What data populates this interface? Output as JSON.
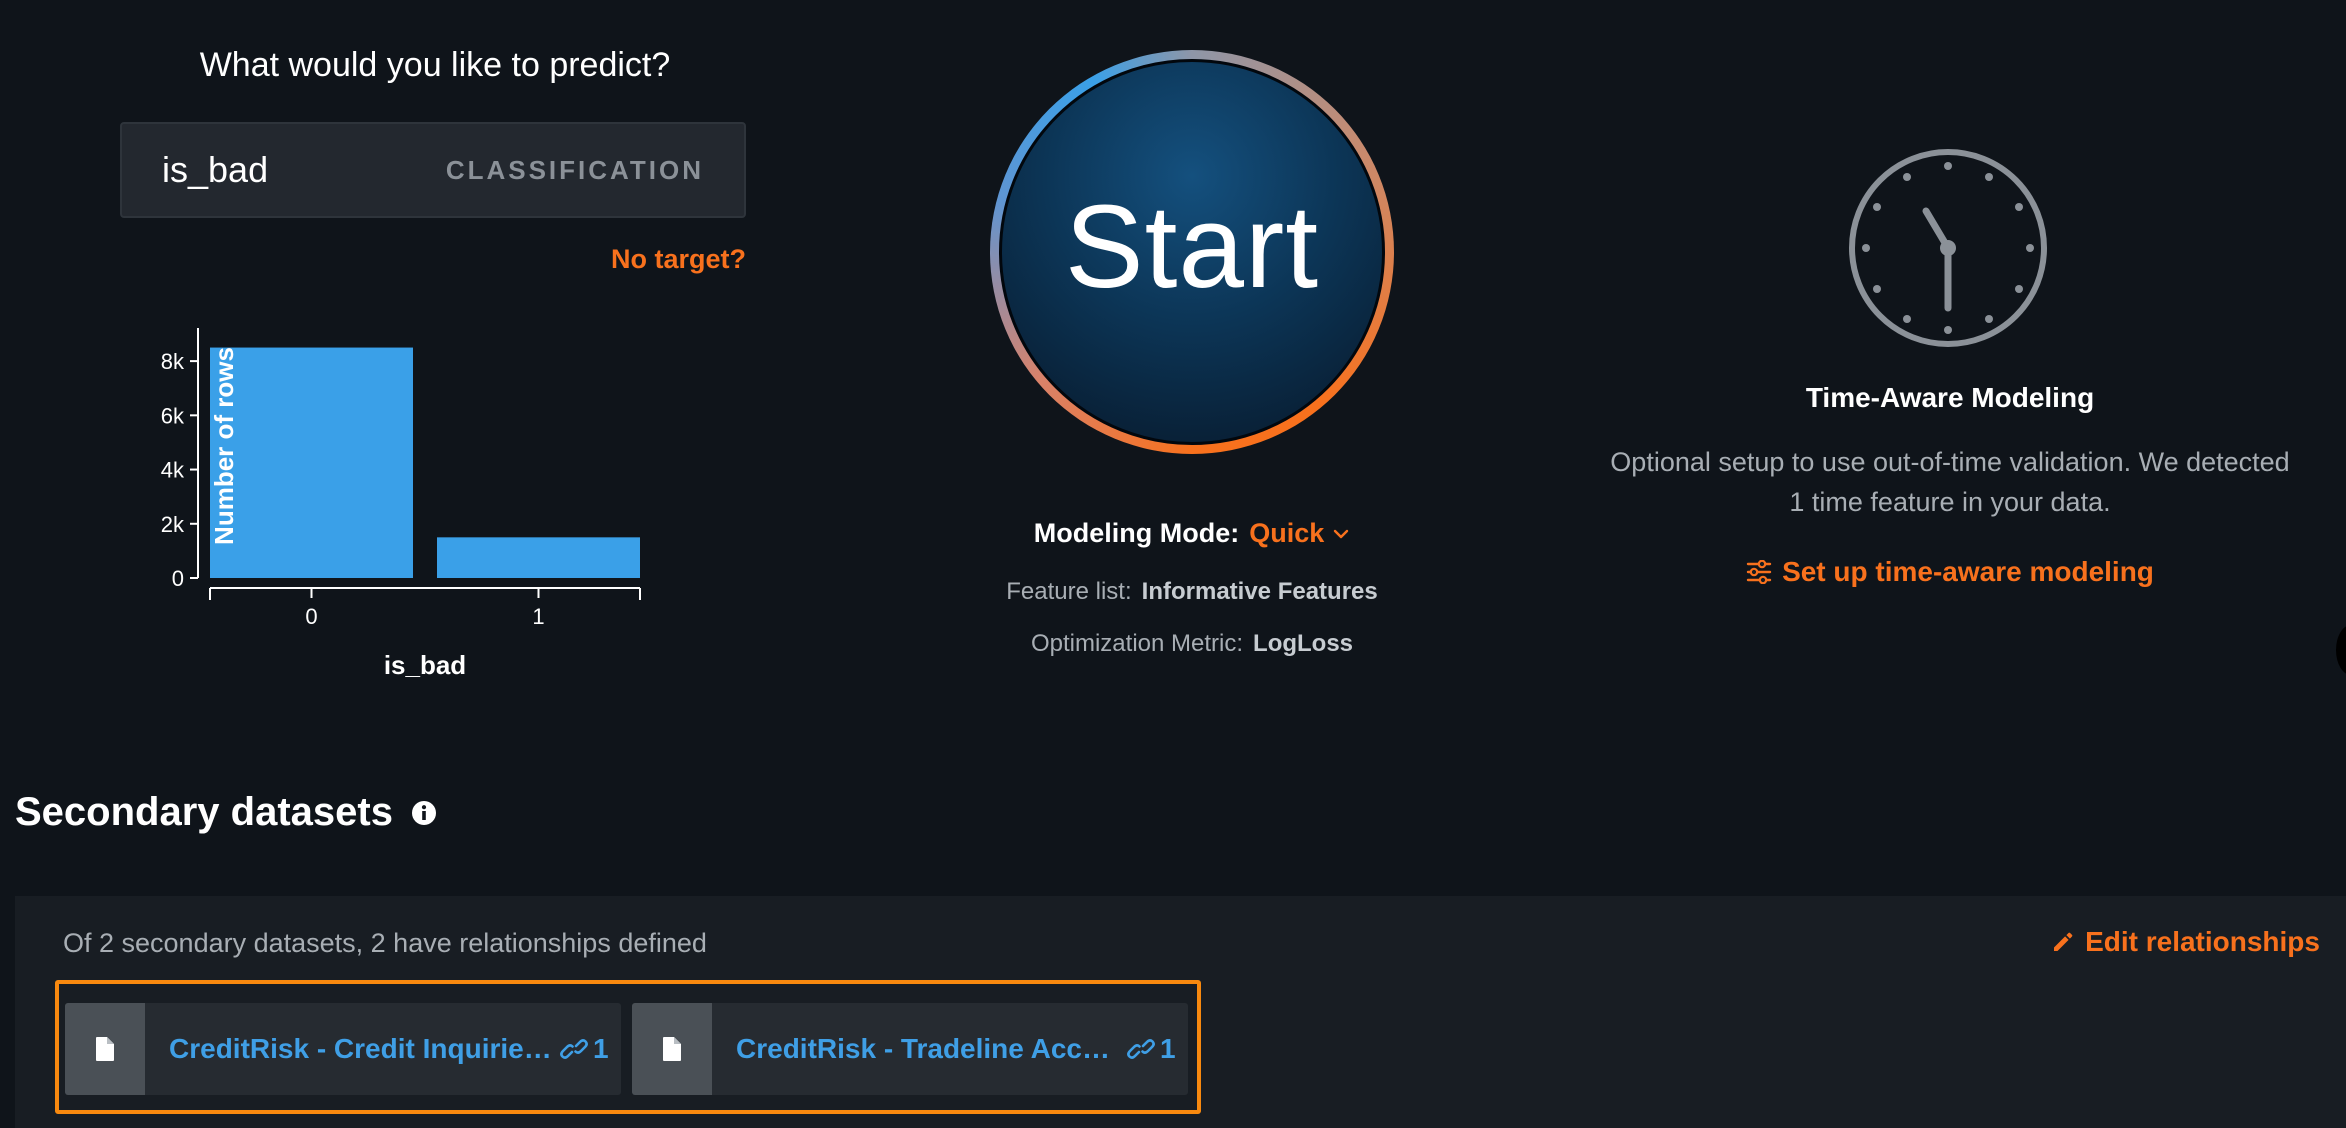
{
  "target": {
    "question": "What would you like to predict?",
    "value": "is_bad",
    "type": "CLASSIFICATION",
    "no_target_link": "No target?"
  },
  "chart_data": {
    "type": "bar",
    "categories": [
      "0",
      "1"
    ],
    "values": [
      8500,
      1500
    ],
    "xlabel": "is_bad",
    "ylabel": "Number of rows",
    "ylim": [
      0,
      9000
    ],
    "yticks": [
      0,
      2000,
      4000,
      6000,
      8000
    ],
    "ytick_labels": [
      "0",
      "2k",
      "4k",
      "6k",
      "8k"
    ],
    "colors": {
      "bar": "#3aa0e8"
    },
    "grid": false
  },
  "start": {
    "label": "Start",
    "mode_label": "Modeling Mode:",
    "mode_value": "Quick",
    "feature_list_label": "Feature list:",
    "feature_list_value": "Informative Features",
    "metric_label": "Optimization Metric:",
    "metric_value": "LogLoss"
  },
  "time_aware": {
    "title": "Time-Aware Modeling",
    "description": "Optional setup to use out-of-time validation. We detected 1 time feature in your data.",
    "link": "Set up time-aware modeling"
  },
  "secondary": {
    "title": "Secondary datasets",
    "summary": "Of 2 secondary datasets, 2 have relationships defined",
    "edit_link": "Edit relationships",
    "datasets": [
      {
        "name": "CreditRisk - Credit Inquiries.csv",
        "relationships": "1"
      },
      {
        "name": "CreditRisk - Tradeline Accounts.csv",
        "relationships": "1"
      }
    ]
  },
  "colors": {
    "background": "#0f141a",
    "accent_orange": "#f8711d",
    "accent_blue": "#3aa0e8",
    "panel": "#181d23"
  }
}
